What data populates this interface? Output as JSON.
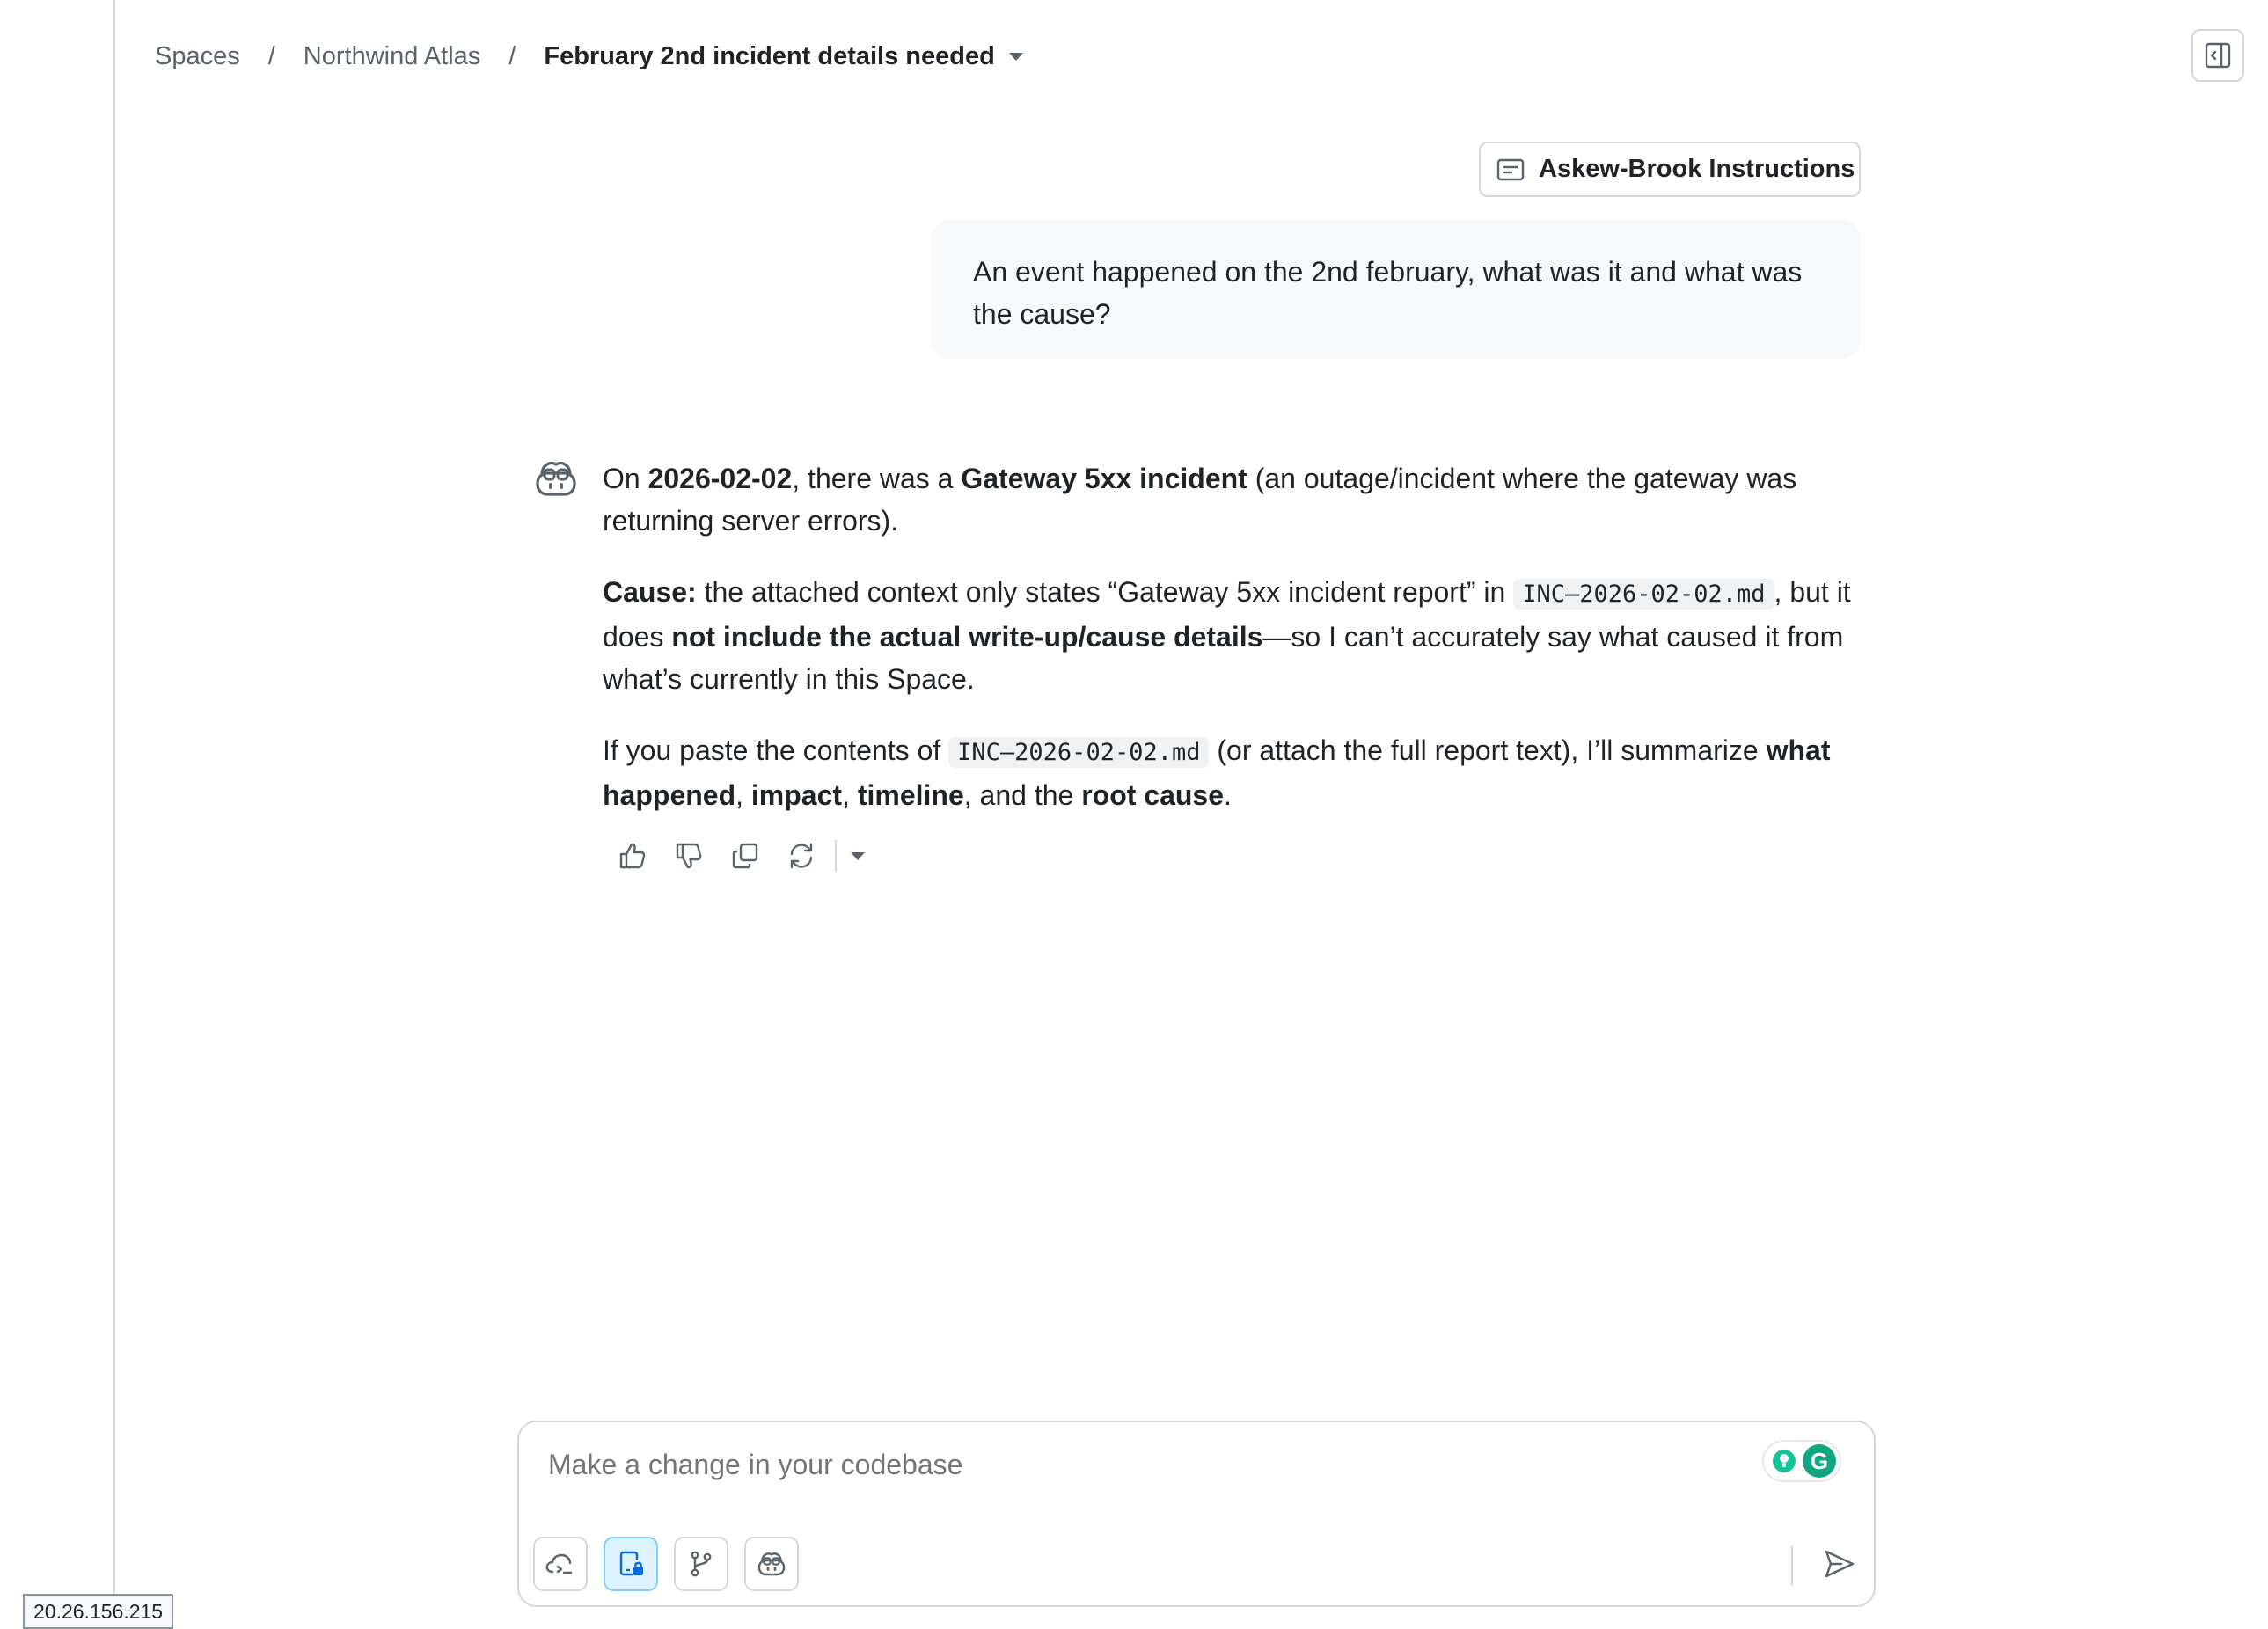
{
  "breadcrumb": {
    "items": [
      "Spaces",
      "Northwind Atlas"
    ],
    "separator": "/",
    "current": "February 2nd incident details needed"
  },
  "instructions": {
    "label": "Askew-Brook Instructions"
  },
  "user_message": {
    "text": "An event happened on the 2nd february, what was it and what was the cause?"
  },
  "answer": {
    "p1": {
      "t1": "On ",
      "b1": "2026-02-02",
      "t2": ", there was a ",
      "b2": "Gateway 5xx incident",
      "t3": " (an outage/incident where the gateway was returning server errors)."
    },
    "p2": {
      "b1": "Cause:",
      "t1": " the attached context only states “Gateway 5xx incident report” in ",
      "code": "INC–2026-02-02.md",
      "t2": ", but it does ",
      "b2": "not include the actual write-up/cause details",
      "t3": "—so I can’t accurately say what caused it from what’s currently in this Space."
    },
    "p3": {
      "t1": "If you paste the contents of ",
      "code": "INC–2026-02-02.md",
      "t2": " (or attach the full report text), I’ll summarize ",
      "b1": "what happened",
      "t3": ", ",
      "b2": "impact",
      "t4": ", ",
      "b3": "timeline",
      "t5": ", and the ",
      "b4": "root cause",
      "t6": "."
    }
  },
  "message_actions": [
    "thumbs-up-icon",
    "thumbs-down-icon",
    "copy-icon",
    "retry-icon",
    "chevron-down-icon"
  ],
  "composer": {
    "placeholder": "Make a change in your codebase",
    "grammarly_letter": "G",
    "tools": [
      "cloud-terminal-icon",
      "device-lock-icon",
      "git-branch-icon",
      "copilot-icon"
    ],
    "send_icon": "paper-airplane-icon"
  },
  "status": {
    "ip": "20.26.156.215"
  },
  "colors": {
    "accent": "#0969da",
    "bubble_bg": "#f6f8fa",
    "border": "#d0d7de",
    "muted_text": "#59636e",
    "grammarly": "#11a683"
  }
}
